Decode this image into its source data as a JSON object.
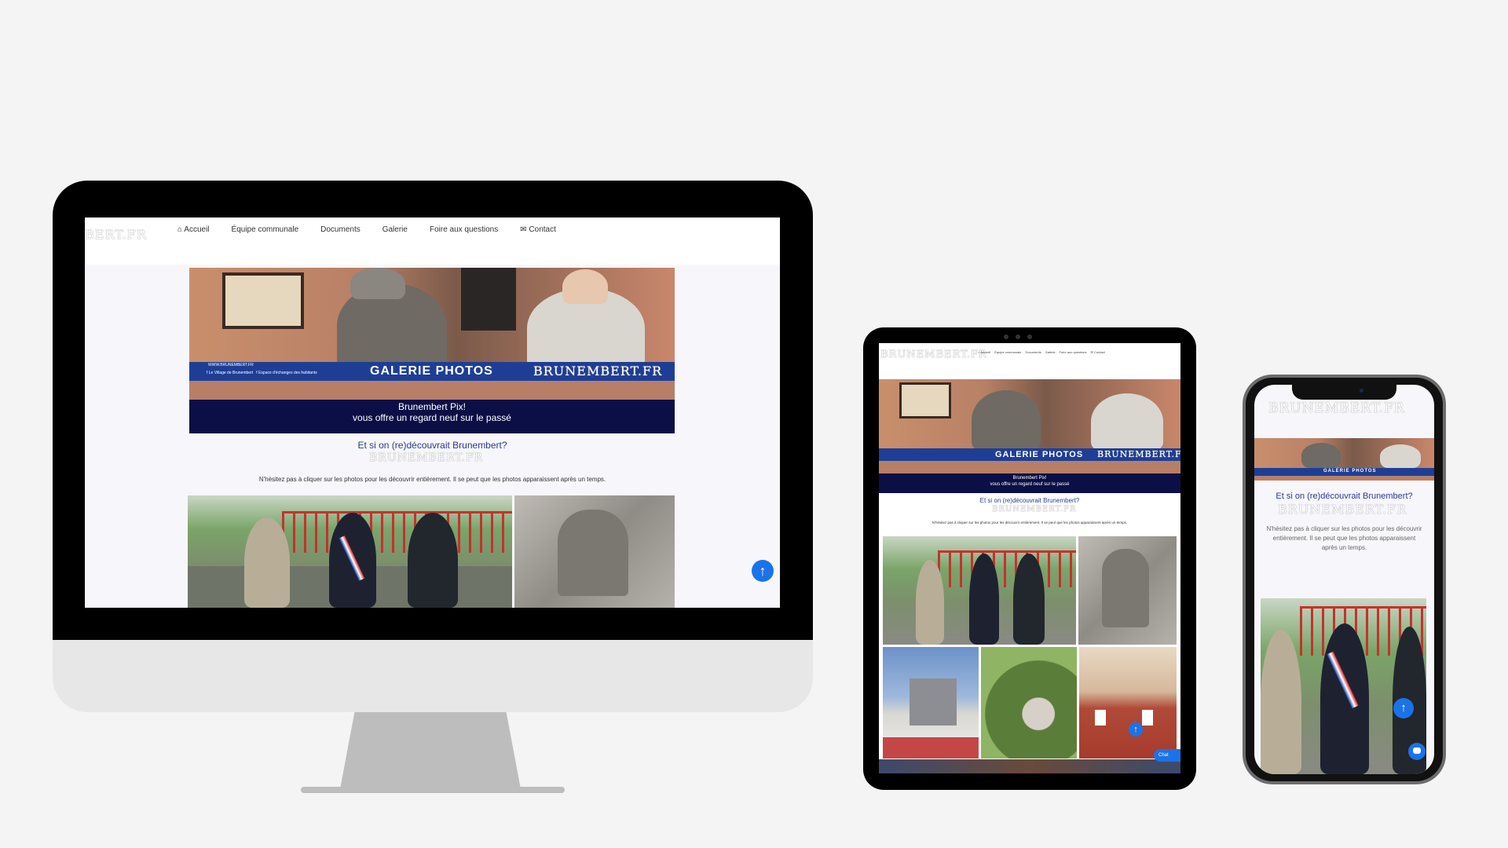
{
  "site": {
    "logo_text": "BRUNEMBERT.FR",
    "logo_text_cropped": "BERT.FR",
    "nav": [
      "Accueil",
      "Équipe communale",
      "Documents",
      "Galerie",
      "Foire aux questions",
      "Contact"
    ],
    "nav_icons": {
      "home": "home-icon",
      "contact": "envelope-icon"
    },
    "banner": {
      "url_text": "WWW.BRUNEMBERT.FR",
      "social_1": "Le Village de Brunembert",
      "social_2": "Espace d'échanges des habitants",
      "title": "GALERIE PHOTOS",
      "watermark": "BRUNEMBERT.FR",
      "caption_line1": "Brunembert Pix!",
      "caption_line2": "vous offre un regard neuf sur le passé"
    },
    "heading": "Et si on (re)découvrait Brunembert?",
    "heading_watermark": "BRUNEMBERT.FR",
    "intro": "N'hésitez pas à cliquer sur les photos pour les découvrir entièrement. Il se peut que les photos apparaissent après un temps.",
    "intro_line1": "N'hésitez pas à cliquer sur les photos pour les découvrir",
    "intro_line2": "entièrement. Il se peut que les photos apparaissent",
    "intro_line3": "après un temps.",
    "chat_label": "Chat",
    "scroll_top_glyph": "↑"
  },
  "colors": {
    "accent": "#1a73e8",
    "brand_blue": "#2b3a93",
    "banner_band": "#1e3e96",
    "banner_dark": "#0c0f45"
  }
}
